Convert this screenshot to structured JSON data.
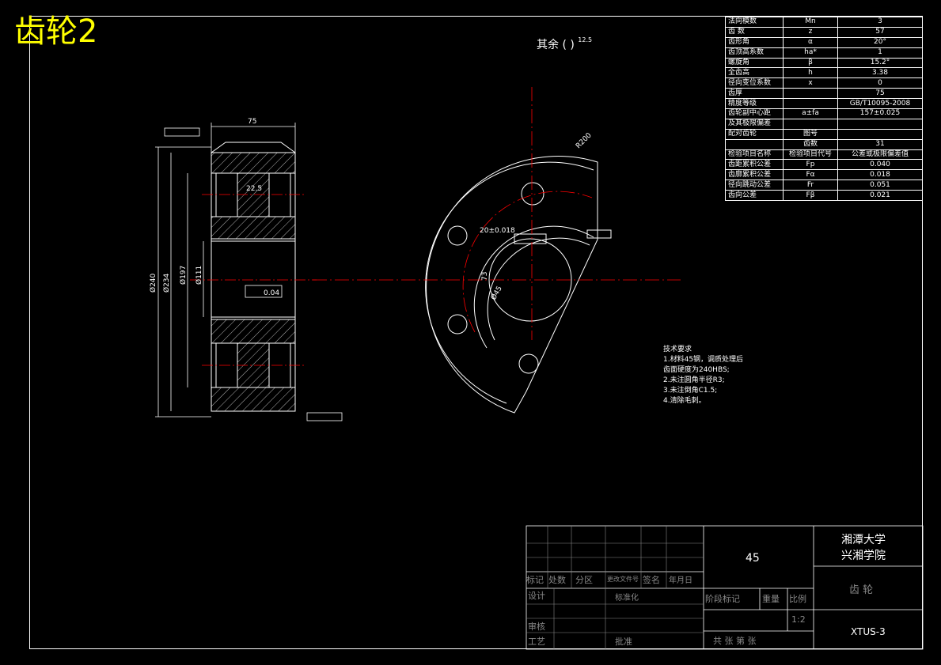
{
  "corner_title": "齿轮2",
  "roughness_note": "其余 ( )",
  "roughness_value": "12.5",
  "params": [
    {
      "name": "法向模数",
      "sym": "Mn",
      "val": "3"
    },
    {
      "name": "齿 数",
      "sym": "z",
      "val": "57"
    },
    {
      "name": "齿形角",
      "sym": "α",
      "val": "20°"
    },
    {
      "name": "齿顶高系数",
      "sym": "ha*",
      "val": "1"
    },
    {
      "name": "螺旋角",
      "sym": "β",
      "val": "15.2°"
    },
    {
      "name": "全齿高",
      "sym": "h",
      "val": "3.38"
    },
    {
      "name": "径向变位系数",
      "sym": "x",
      "val": "0"
    },
    {
      "name": "齿厚",
      "sym": "",
      "val": "75"
    },
    {
      "name": "精度等级",
      "sym": "",
      "val": "GB/T10095-2008"
    },
    {
      "name": "齿轮副中心距",
      "sym": "a±fa",
      "val": "157±0.025"
    },
    {
      "name": "及其极限偏差",
      "sym": "",
      "val": ""
    },
    {
      "name": "配对齿轮",
      "sym": "图号",
      "val": ""
    },
    {
      "name": "",
      "sym": "齿数",
      "val": "31"
    },
    {
      "name": "检验项目名称",
      "sym": "检验项目代号",
      "val": "公差或极限偏差值"
    },
    {
      "name": "齿距累积公差",
      "sym": "Fp",
      "val": "0.040"
    },
    {
      "name": "齿廓累积公差",
      "sym": "Fα",
      "val": "0.018"
    },
    {
      "name": "径向跳动公差",
      "sym": "Fr",
      "val": "0.051"
    },
    {
      "name": "齿向公差",
      "sym": "Fβ",
      "val": "0.021"
    }
  ],
  "tech_requirements": {
    "title": "技术要求",
    "lines": [
      "1.材料45钢，调质处理后",
      "齿面硬度为240HBS;",
      "2.未注圆角半径R3;",
      "3.未注倒角C1.5;",
      "4.清除毛刺。"
    ]
  },
  "dims": {
    "width": "75",
    "hub_width": "22.5",
    "d_tip": "Ø240",
    "d_234": "Ø234",
    "d_197": "Ø197",
    "d_111": "Ø111",
    "runout": "0.04",
    "keyway": "20±0.018",
    "bore": "Ø45",
    "key_depth": "73",
    "r200": "R200"
  },
  "title_block": {
    "material": "45",
    "school_1": "湘潭大学",
    "school_2": "兴湘学院",
    "part_name": "齿 轮",
    "drawing_no": "XTUS-3",
    "scale": "1:2",
    "labels": {
      "mark": "标记",
      "count": "处数",
      "zone": "分区",
      "change_doc": "更改文件号",
      "sign": "签名",
      "date": "年月日",
      "design": "设计",
      "standard": "标准化",
      "review": "审核",
      "process": "工艺",
      "approve": "批准",
      "stage": "阶段标记",
      "weight": "重量",
      "ratio": "比例",
      "sheets": "共  张  第  张"
    }
  }
}
